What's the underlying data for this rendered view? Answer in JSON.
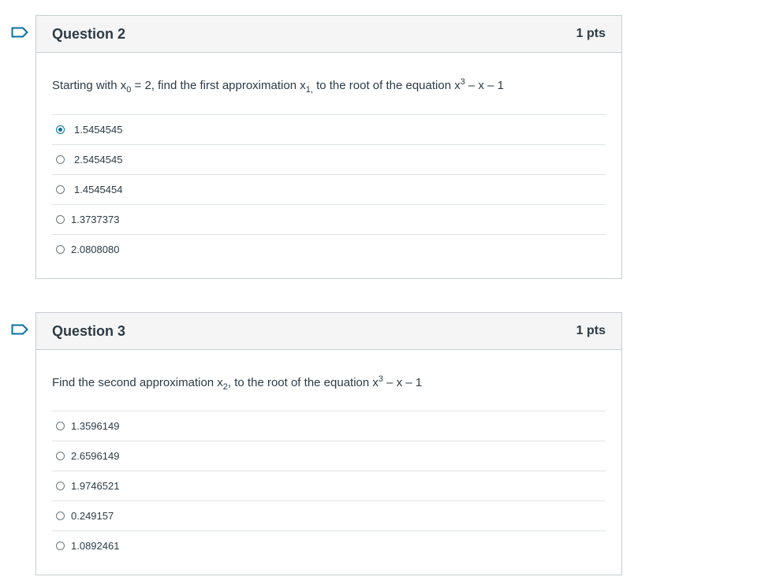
{
  "questions": [
    {
      "title": "Question 2",
      "points": "1 pts",
      "text": {
        "p1": "Starting with x",
        "sub1": "0",
        "p2": " = 2, find the first approximation x",
        "sub2": "1,",
        "p3": " to the root of the equation x",
        "sup": "3",
        "p4": " – x – 1"
      },
      "answers": [
        {
          "label": "1.5454545",
          "selected": true
        },
        {
          "label": "2.5454545",
          "selected": false
        },
        {
          "label": "1.4545454",
          "selected": false
        },
        {
          "label": "1.3737373",
          "selected": false
        },
        {
          "label": "2.0808080",
          "selected": false
        }
      ]
    },
    {
      "title": "Question 3",
      "points": "1 pts",
      "text": {
        "p1": "Find  the second approximation x",
        "sub1": "2",
        "p2": ", to the root of the equation x",
        "sup": "3",
        "p3": " – x – 1"
      },
      "answers": [
        {
          "label": "1.3596149",
          "selected": false
        },
        {
          "label": "2.6596149",
          "selected": false
        },
        {
          "label": "1.9746521",
          "selected": false
        },
        {
          "label": "0.249157",
          "selected": false
        },
        {
          "label": "1.0892461",
          "selected": false
        }
      ]
    }
  ],
  "colors": {
    "accent": "#0770a3",
    "border": "#c7cdd1",
    "header_bg": "#f5f5f5"
  },
  "icons": {
    "flag": "flag-outline-icon"
  }
}
